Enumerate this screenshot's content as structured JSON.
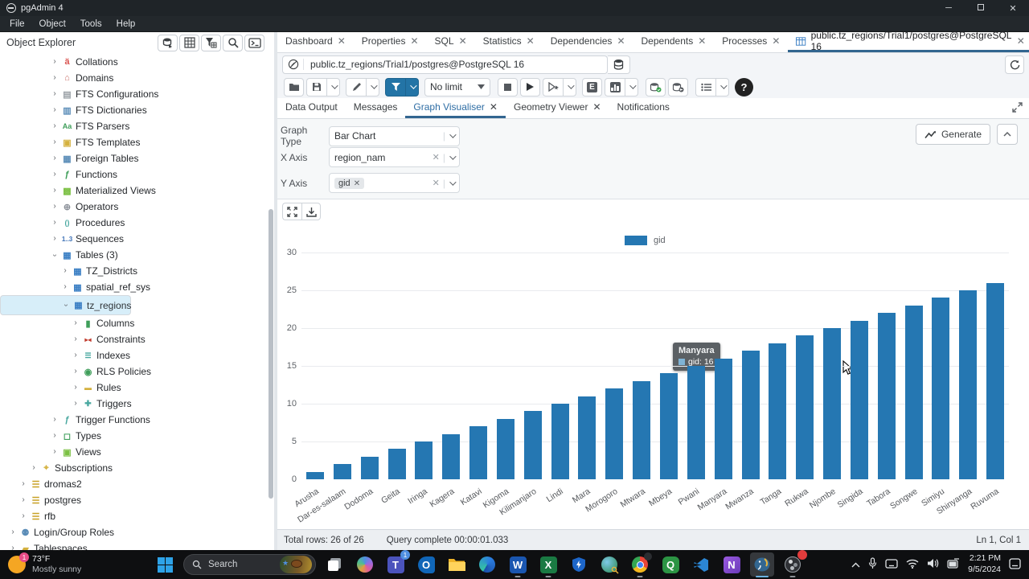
{
  "window": {
    "title": "pgAdmin 4",
    "minimize": "─",
    "maximize": "",
    "close": "✕"
  },
  "menubar": [
    "File",
    "Object",
    "Tools",
    "Help"
  ],
  "object_explorer": {
    "title": "Object Explorer",
    "toolbar_icons": [
      "connect-database-icon",
      "table-grid-icon",
      "filter-table-icon",
      "search-icon",
      "terminal-icon"
    ],
    "tree": [
      {
        "label": "Collations",
        "depth": 6,
        "icon": "collations"
      },
      {
        "label": "Domains",
        "depth": 6,
        "icon": "domains"
      },
      {
        "label": "FTS Configurations",
        "depth": 6,
        "icon": "fts-configurations"
      },
      {
        "label": "FTS Dictionaries",
        "depth": 6,
        "icon": "fts-dictionaries"
      },
      {
        "label": "FTS Parsers",
        "depth": 6,
        "icon": "fts-parsers"
      },
      {
        "label": "FTS Templates",
        "depth": 6,
        "icon": "fts-templates"
      },
      {
        "label": "Foreign Tables",
        "depth": 6,
        "icon": "foreign-tables"
      },
      {
        "label": "Functions",
        "depth": 6,
        "icon": "functions"
      },
      {
        "label": "Materialized Views",
        "depth": 6,
        "icon": "materialized-views"
      },
      {
        "label": "Operators",
        "depth": 6,
        "icon": "operators"
      },
      {
        "label": "Procedures",
        "depth": 6,
        "icon": "procedures"
      },
      {
        "label": "Sequences",
        "depth": 6,
        "icon": "sequences"
      },
      {
        "label": "Tables (3)",
        "depth": 6,
        "icon": "tables",
        "expanded": true
      },
      {
        "label": "TZ_Districts",
        "depth": 7,
        "icon": "table"
      },
      {
        "label": "spatial_ref_sys",
        "depth": 7,
        "icon": "table"
      },
      {
        "label": "tz_regions",
        "depth": 7,
        "icon": "table",
        "expanded": true,
        "selected": true
      },
      {
        "label": "Columns",
        "depth": 8,
        "icon": "columns"
      },
      {
        "label": "Constraints",
        "depth": 8,
        "icon": "constraints"
      },
      {
        "label": "Indexes",
        "depth": 8,
        "icon": "indexes"
      },
      {
        "label": "RLS Policies",
        "depth": 8,
        "icon": "rls-policies"
      },
      {
        "label": "Rules",
        "depth": 8,
        "icon": "rules"
      },
      {
        "label": "Triggers",
        "depth": 8,
        "icon": "triggers"
      },
      {
        "label": "Trigger Functions",
        "depth": 6,
        "icon": "trigger-functions"
      },
      {
        "label": "Types",
        "depth": 6,
        "icon": "types"
      },
      {
        "label": "Views",
        "depth": 6,
        "icon": "views"
      },
      {
        "label": "Subscriptions",
        "depth": 4,
        "icon": "subscriptions"
      },
      {
        "label": "dromas2",
        "depth": 3,
        "icon": "database"
      },
      {
        "label": "postgres",
        "depth": 3,
        "icon": "database"
      },
      {
        "label": "rfb",
        "depth": 3,
        "icon": "database"
      },
      {
        "label": "Login/Group Roles",
        "depth": 2,
        "icon": "login-group-roles"
      },
      {
        "label": "Tablespaces",
        "depth": 2,
        "icon": "tablespaces"
      }
    ]
  },
  "tabs": [
    {
      "label": "Dashboard"
    },
    {
      "label": "Properties"
    },
    {
      "label": "SQL"
    },
    {
      "label": "Statistics"
    },
    {
      "label": "Dependencies"
    },
    {
      "label": "Dependents"
    },
    {
      "label": "Processes"
    },
    {
      "label": "public.tz_regions/Trial1/postgres@PostgreSQL 16",
      "active": true,
      "icon": "table"
    }
  ],
  "query_tool": {
    "connection": "public.tz_regions/Trial1/postgres@PostgreSQL 16",
    "limit": "No limit",
    "result_tabs": [
      {
        "label": "Data Output"
      },
      {
        "label": "Messages"
      },
      {
        "label": "Graph Visualiser",
        "active": true,
        "closable": true
      },
      {
        "label": "Geometry Viewer",
        "closable": true
      },
      {
        "label": "Notifications"
      }
    ]
  },
  "graph": {
    "type_label": "Graph Type",
    "type_value": "Bar Chart",
    "x_label": "X Axis",
    "x_value": "region_nam",
    "y_label": "Y Axis",
    "y_chip": "gid",
    "generate_label": "Generate"
  },
  "chart_data": {
    "type": "bar",
    "legend": [
      "gid"
    ],
    "legend_position": "top",
    "categories": [
      "Arusha",
      "Dar-es-salaam",
      "Dodoma",
      "Geita",
      "Iringa",
      "Kagera",
      "Katavi",
      "Kigoma",
      "Kilimanjaro",
      "Lindi",
      "Mara",
      "Morogoro",
      "Mtwara",
      "Mbeya",
      "Pwani",
      "Manyara",
      "Mwanza",
      "Tanga",
      "Rukwa",
      "Njombe",
      "Singida",
      "Tabora",
      "Songwe",
      "Simiyu",
      "Shinyanga",
      "Ruvuma"
    ],
    "series": [
      {
        "name": "gid",
        "values": [
          1,
          2,
          3,
          4,
          5,
          6,
          7,
          8,
          9,
          10,
          11,
          12,
          13,
          14,
          15,
          16,
          17,
          18,
          19,
          20,
          21,
          22,
          23,
          24,
          25,
          26
        ]
      }
    ],
    "xlabel": "",
    "ylabel": "",
    "ylim": [
      0,
      30
    ],
    "yticks": [
      0,
      5,
      10,
      15,
      20,
      25,
      30
    ],
    "grid": true,
    "bar_color": "#2577b2",
    "tooltip": {
      "category": "Manyara",
      "series": "gid",
      "value": 16,
      "line2": "gid: 16"
    }
  },
  "status_bar": {
    "rows": "Total rows: 26 of 26",
    "query": "Query complete 00:00:01.033",
    "cursor_pos": "Ln 1, Col 1"
  },
  "taskbar": {
    "weather_temp": "73°F",
    "weather_desc": "Mostly sunny",
    "weather_badge": "1",
    "search_placeholder": "Search",
    "teams_badge": "1",
    "time": "2:21 PM",
    "date": "9/5/2024"
  }
}
